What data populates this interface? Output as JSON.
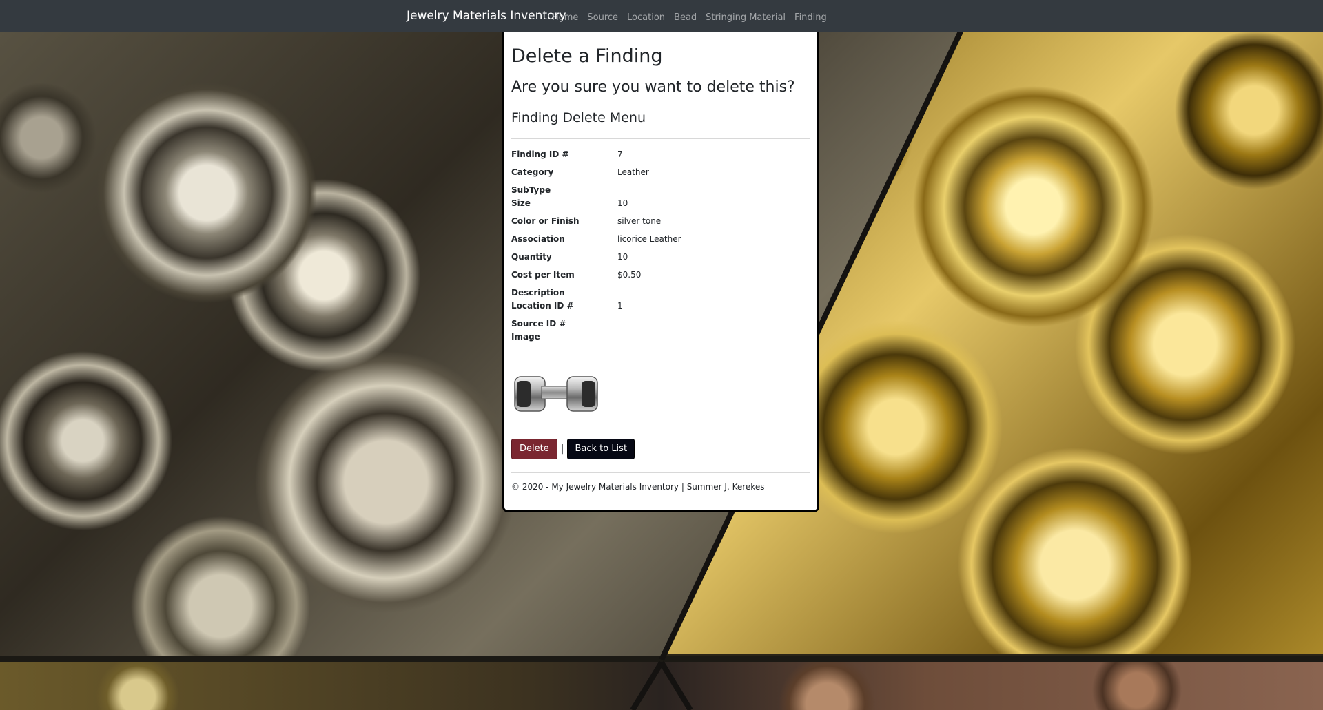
{
  "navbar": {
    "brand": "Jewelry Materials Inventory",
    "links": [
      "Home",
      "Source",
      "Location",
      "Bead",
      "Stringing Material",
      "Finding"
    ]
  },
  "page": {
    "title": "Delete a Finding",
    "confirm": "Are you sure you want to delete this?",
    "subtitle": "Finding Delete Menu"
  },
  "details": [
    {
      "label": "Finding ID #",
      "value": "7"
    },
    {
      "label": "Category",
      "value": "Leather"
    },
    {
      "label": "SubType",
      "value": ""
    },
    {
      "label": "Size",
      "value": "10"
    },
    {
      "label": "Color or Finish",
      "value": "silver tone"
    },
    {
      "label": "Association",
      "value": "licorice Leather"
    },
    {
      "label": "Quantity",
      "value": "10"
    },
    {
      "label": "Cost per Item",
      "value": "$0.50"
    },
    {
      "label": "Description",
      "value": ""
    },
    {
      "label": "Location ID #",
      "value": "1"
    },
    {
      "label": "Source ID #",
      "value": ""
    },
    {
      "label": "Image",
      "value": ""
    }
  ],
  "actions": {
    "delete_label": "Delete",
    "separator": "|",
    "back_label": "Back to List"
  },
  "footer": {
    "text": "© 2020 - My Jewelry Materials Inventory | Summer J. Kerekes"
  },
  "colors": {
    "navbar_bg": "#343a40",
    "delete_button": "#7a2630",
    "back_button": "#060814"
  },
  "icons": {
    "finding_image": "silver-crimp-clasp-image"
  }
}
